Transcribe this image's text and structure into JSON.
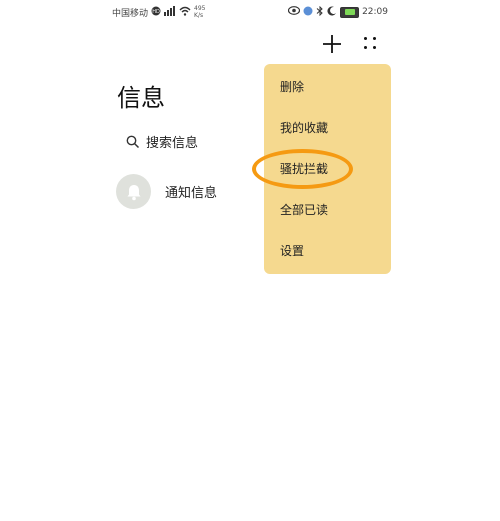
{
  "status_bar": {
    "carrier": "中国移动",
    "speed_value": "495",
    "speed_unit": "K/s",
    "time": "22:09"
  },
  "header": {
    "title": "信息",
    "add_icon": "plus-icon",
    "more_icon": "grid-dots-icon"
  },
  "search": {
    "icon": "search-icon",
    "label": "搜索信息"
  },
  "conversations": [
    {
      "icon": "bell-icon",
      "label": "通知信息"
    }
  ],
  "menu": {
    "items": [
      {
        "label": "删除"
      },
      {
        "label": "我的收藏"
      },
      {
        "label": "骚扰拦截"
      },
      {
        "label": "全部已读"
      },
      {
        "label": "设置"
      }
    ]
  },
  "colors": {
    "menu_background": "#f5d98f",
    "highlight_ring": "#f59a12",
    "avatar_background": "#dfe1dc"
  }
}
